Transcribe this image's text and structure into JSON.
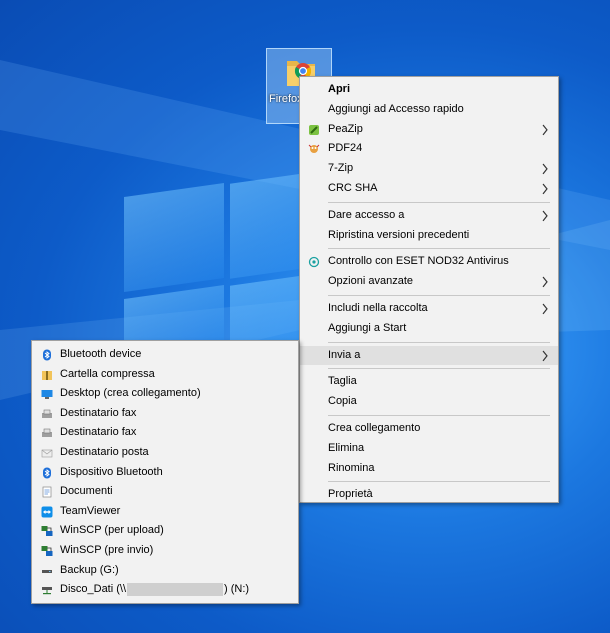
{
  "desktop_icon": {
    "label_line1": "Firefox",
    "label_line2": "",
    "icon": "folder-with-browser-icon"
  },
  "context_menu": {
    "items": [
      {
        "label": "Apri",
        "bold": true
      },
      {
        "label": "Aggiungi ad Accesso rapido"
      },
      {
        "label": "PeaZip",
        "icon": "peazip-icon",
        "submenu": true
      },
      {
        "label": "PDF24",
        "icon": "pdf24-icon"
      },
      {
        "label": "7-Zip",
        "submenu": true
      },
      {
        "label": "CRC SHA",
        "submenu": true
      },
      {
        "label": "Dare accesso a",
        "submenu": true
      },
      {
        "label": "Ripristina versioni precedenti"
      },
      {
        "label": "Controllo con ESET NOD32 Antivirus",
        "icon": "eset-icon"
      },
      {
        "label": "Opzioni avanzate",
        "submenu": true
      },
      {
        "label": "Includi nella raccolta",
        "submenu": true
      },
      {
        "label": "Aggiungi a Start"
      },
      {
        "label": "Invia a",
        "submenu": true,
        "highlighted": true
      },
      {
        "label": "Taglia"
      },
      {
        "label": "Copia"
      },
      {
        "label": "Crea collegamento"
      },
      {
        "label": "Elimina"
      },
      {
        "label": "Rinomina"
      },
      {
        "label": "Proprietà"
      }
    ]
  },
  "send_to_menu": {
    "items": [
      {
        "label": "Bluetooth device",
        "icon": "bluetooth-icon"
      },
      {
        "label": "Cartella compressa",
        "icon": "zip-folder-icon"
      },
      {
        "label": "Desktop (crea collegamento)",
        "icon": "desktop-icon"
      },
      {
        "label": "Destinatario fax",
        "icon": "fax-icon"
      },
      {
        "label": "Destinatario fax",
        "icon": "fax-icon"
      },
      {
        "label": "Destinatario posta",
        "icon": "mail-icon"
      },
      {
        "label": "Dispositivo Bluetooth",
        "icon": "bluetooth-icon"
      },
      {
        "label": "Documenti",
        "icon": "documents-icon"
      },
      {
        "label": "TeamViewer",
        "icon": "teamviewer-icon"
      },
      {
        "label": "WinSCP (per upload)",
        "icon": "winscp-icon"
      },
      {
        "label": "WinSCP (pre invio)",
        "icon": "winscp-icon"
      },
      {
        "label": "Backup (G:)",
        "icon": "drive-icon"
      },
      {
        "label_prefix": "Disco_Dati (\\\\",
        "label_suffix": ") (N:)",
        "icon": "network-drive-icon"
      }
    ]
  },
  "colors": {
    "menu_bg": "#f2f2f2",
    "highlight": "#e0e0e0",
    "desktop_blue": "#0d5bc8"
  }
}
